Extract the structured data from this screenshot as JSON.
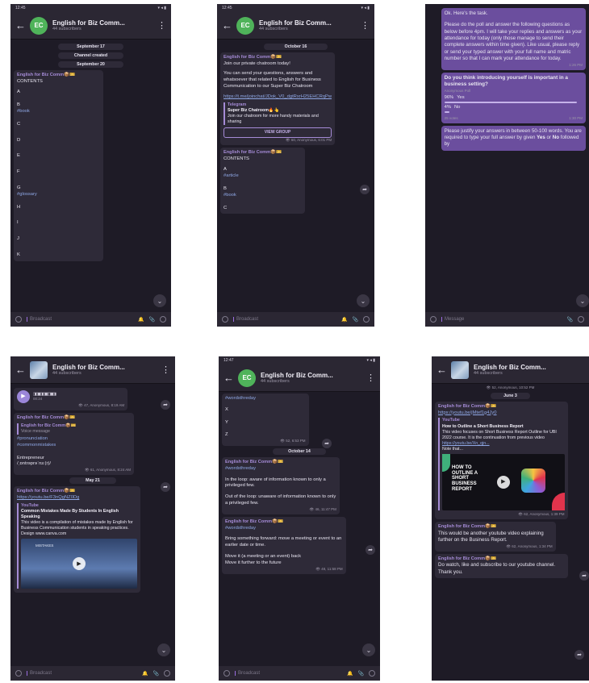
{
  "composer_placeholder": "Broadcast",
  "composer_message": "Message",
  "channel": {
    "title": "English for Biz Comm...",
    "subscribers": "44 subscribers",
    "initials": "EC",
    "sender": "English for Biz Comm📦🎫"
  },
  "statusbar": {
    "time_a": "12:45",
    "time_b": "12:47",
    "icons": "▾ ◂ ▮"
  },
  "p1": {
    "dates": [
      "September 17",
      "Channel created",
      "September 20"
    ],
    "contents": "CONTENTS",
    "lines": [
      "A",
      "B",
      "#book",
      "C",
      "D",
      "E",
      "F",
      "G",
      "#glossary",
      "H",
      "I",
      "J",
      "K"
    ]
  },
  "p2": {
    "date": "October 16",
    "line1": "Join our private chatroom today!",
    "line2": "You can send your questions, answers and whatsoever that related to English for Business Communication to our Super Biz Chatroom",
    "link": "https://t.me/joinchat/JDok_V0_dgtRxrH25EHCRqPw",
    "preview_site": "Telegram",
    "preview_title": "Super Biz Chatroom🔥👆",
    "preview_desc": "Join our chatroom for more handy materials and sharing",
    "view_group": "VIEW GROUP",
    "meta": "👁 60, Anonymous, 6:01 PM",
    "contents": "CONTENTS",
    "lines": [
      "A",
      "#article",
      "B",
      "#book",
      "C"
    ]
  },
  "p3": {
    "text1": "Ok. Here's the task.",
    "text2": "Please do the poll and answer the following questions as below before 4pm.  I will take your replies and answers as your attendance for today (only those manage to send their complete answers within time given). Like usual, please reply or send your typed answer with your full name and matric number so that I can mark your attendance for today.",
    "meta1": "1:26 PM",
    "poll_q": "Do you think introducing yourself is important in a business setting?",
    "poll_type": "Anonymous Poll",
    "opt1_pct": "96%",
    "opt1": "Yes",
    "opt1_value": 0.96,
    "opt2_pct": "4%",
    "opt2": "No",
    "opt2_value": 0.04,
    "votes": "25 votes",
    "meta2": "1:30 PM",
    "text3a": "Please justify your answers in between 50-100 words. You are required to type your full answer by given ",
    "text3_yes": "Yes",
    "text3_or": " or ",
    "text3_no": "No",
    "text3b": " followed by"
  },
  "p4": {
    "voice_wave": "▯▮▯▮▮▯▮▯▮▮▯▯▮▮▯▮",
    "voice_dur": "00:24",
    "meta_voice": "👁 47, Anonymous, 8:19 AM",
    "fwd_label": "Voice message",
    "tags1": "#pronunciation",
    "tags2": "#commonmistakes",
    "word": "Entrepreneur",
    "ipa": "/ˌɒntrəprəˈnɜː(r)/",
    "meta1": "👁 61, Anonymous, 8:24 AM",
    "date": "May 21",
    "link": "https://youtu.be/F3nQgNZ0Dg",
    "site": "YouTube",
    "title": "Common Mistakes Made By Students In English Speaking",
    "desc": "This video is a compilation of mistakes made by English for Business Communication students in speaking practices. Design www.canva.com",
    "thumb_text": "MISTAKES"
  },
  "p5": {
    "tag_top": "#wordsthreday",
    "lines_top": [
      "X",
      "Y",
      "Z"
    ],
    "meta_top": "👁 52, 6:53 PM",
    "date": "October 14",
    "tag1": "#wordsthreday",
    "m1_a": "In the loop: aware of information known to only a privileged few.",
    "m1_b": "Out of the loop: unaware of information known to only a privileged few.",
    "meta1": "👁 46, 11:47 PM",
    "tag2": "#wordsthreday",
    "m2_a": "Bring something forward: move a meeting or event to an earlier date or time.",
    "m2_b": "Move it (a meeting or an event) back",
    "m2_c": "Move it further to the future",
    "meta2": "👁 48, 11:58 PM"
  },
  "p6": {
    "meta_top": "👁 52, Anonymous, 10:52 PM",
    "date": "June 3",
    "link": "https://youtu.be/jMtef1g4Jy0",
    "site": "YouTube",
    "title": "How to Outline a Short Business Report",
    "desc": "This video focuses on Short Business Report Outline for UBI 2022 course. It is the continuation from previous video",
    "link2": "https://youtu.be/Xn_qjn...",
    "desc2": "Note that...",
    "thumb_l1": "HOW TO",
    "thumb_l2": "OUTLINE A",
    "thumb_l3": "SHORT",
    "thumb_l4": "BUSINESS",
    "thumb_l5": "REPORT",
    "meta1": "👁 62, Anonymous, 1:39 PM",
    "m2": "This would be another youtube video explaining further on the Business Report.",
    "meta2": "👁 62, Anonymous, 1:34 PM",
    "m3": "Do watch, like and subscribe to our youtube channel. Thank you."
  }
}
